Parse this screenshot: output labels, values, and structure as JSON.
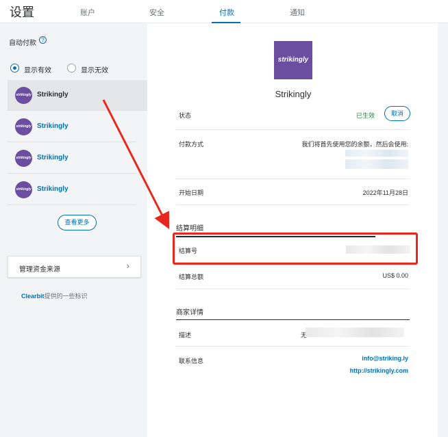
{
  "header": {
    "title": "设置",
    "tabs": [
      {
        "label": "账户"
      },
      {
        "label": "安全"
      },
      {
        "label": "付款"
      },
      {
        "label": "通知"
      }
    ]
  },
  "sidebar": {
    "autopay_label": "自动付款",
    "help_icon": "?",
    "filter_active_label": "显示有效",
    "filter_inactive_label": "显示无效",
    "merchants": [
      {
        "name": "Strikingly",
        "logo_text": "strikingly"
      },
      {
        "name": "Strikingly",
        "logo_text": "strikingly"
      },
      {
        "name": "Strikingly",
        "logo_text": "strikingly"
      },
      {
        "name": "Strikingly",
        "logo_text": "strikingly"
      }
    ],
    "view_more_label": "查看更多",
    "manage_funding_label": "管理资金来源",
    "manage_chevron": "›",
    "clearbit_brand": "Clearbit",
    "clearbit_suffix": "提供的一些标识"
  },
  "detail": {
    "logo_text": "strikingly",
    "merchant_name": "Strikingly",
    "status_label": "状态",
    "status_value": "已生效",
    "cancel_label": "取消",
    "payment_method_label": "付款方式",
    "payment_method_value": "我们将首先使用您的余额，然后会使用:",
    "start_date_label": "开始日期",
    "start_date_value": "2022年11月28日",
    "billing_section_title": "结算明细",
    "billing_id_label": "结算号",
    "billing_total_label": "结算总额",
    "billing_total_value": "US$ 0.00",
    "merchant_section_title": "商家详情",
    "description_label": "描述",
    "description_prefix": "无",
    "contact_label": "联系信息",
    "contact_email": "info@striking.ly",
    "contact_url": "http://strikingly.com"
  },
  "colors": {
    "accent": "#0070ba",
    "status_green": "#1f8e2e",
    "brand_purple": "#6b4ea0",
    "annotation_red": "#e8281e"
  }
}
